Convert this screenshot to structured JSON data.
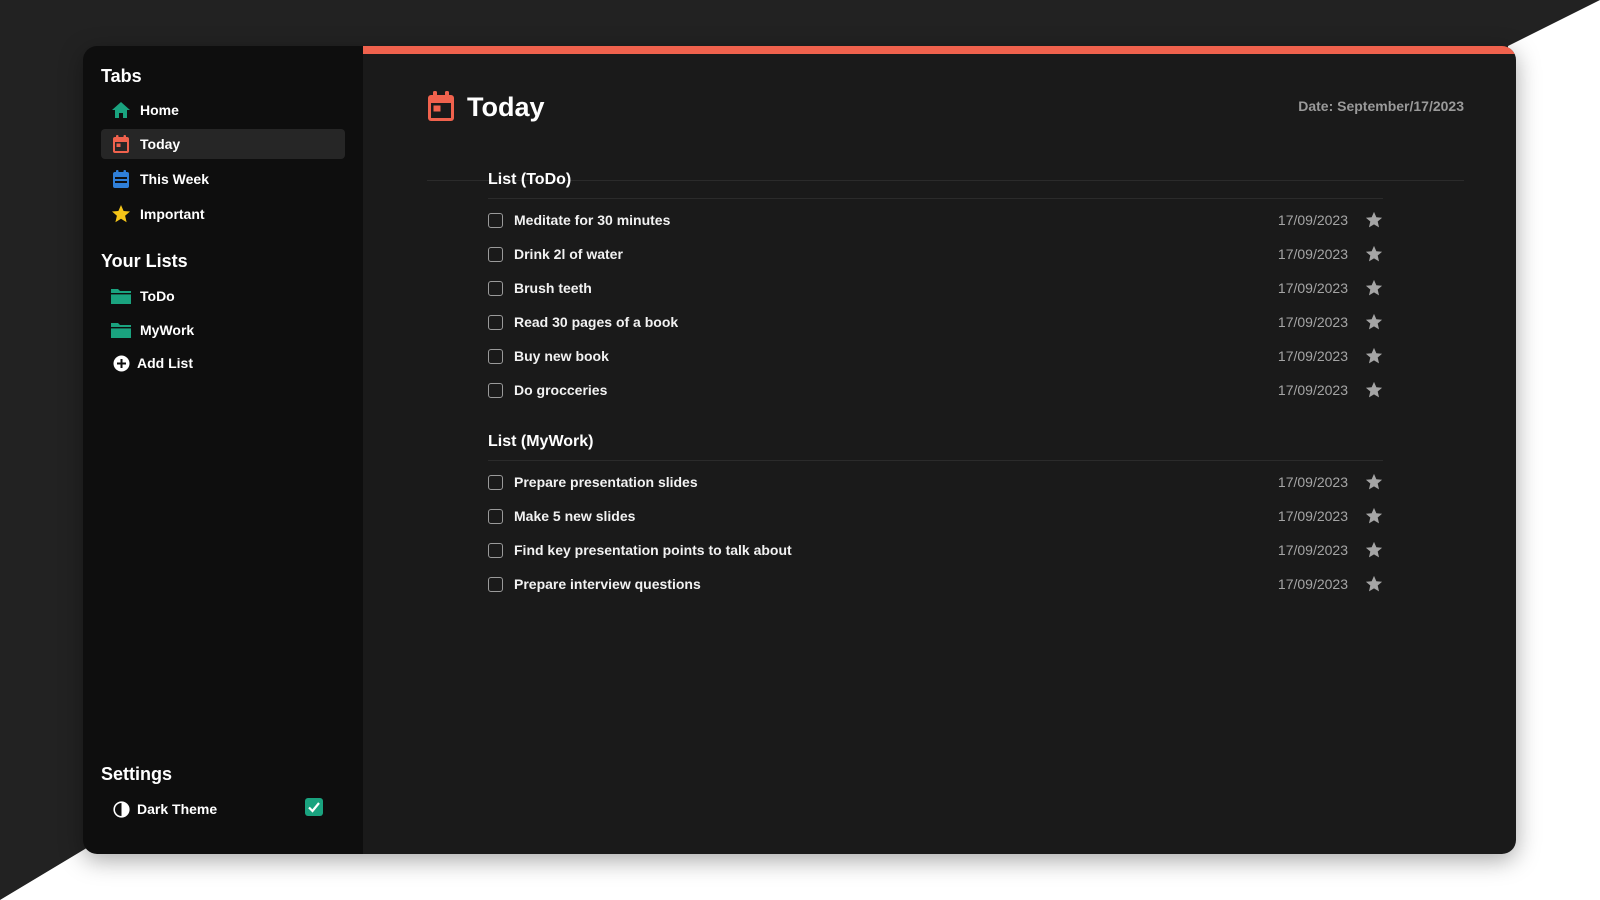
{
  "sidebar": {
    "tabs_title": "Tabs",
    "tabs": [
      {
        "label": "Home",
        "icon": "home-icon",
        "color": "#1aa37f"
      },
      {
        "label": "Today",
        "icon": "calendar-icon",
        "color": "#f0624d",
        "active": true
      },
      {
        "label": "This Week",
        "icon": "calendar-week-icon",
        "color": "#2f7fd8"
      },
      {
        "label": "Important",
        "icon": "star-icon",
        "color": "#f5c518"
      }
    ],
    "lists_title": "Your Lists",
    "lists": [
      {
        "label": "ToDo",
        "icon": "folder-icon",
        "color": "#1aa37f"
      },
      {
        "label": "MyWork",
        "icon": "folder-icon",
        "color": "#1aa37f"
      }
    ],
    "add_list_label": "Add List",
    "settings_title": "Settings",
    "dark_theme_label": "Dark Theme",
    "dark_theme_enabled": true
  },
  "header": {
    "title": "Today",
    "date_label": "Date: September/17/2023",
    "accent_color": "#f0624d"
  },
  "sections": [
    {
      "title": "List (ToDo)",
      "tasks": [
        {
          "text": "Meditate for 30 minutes",
          "date": "17/09/2023"
        },
        {
          "text": "Drink 2l of water",
          "date": "17/09/2023"
        },
        {
          "text": "Brush teeth",
          "date": "17/09/2023"
        },
        {
          "text": "Read 30 pages of a book",
          "date": "17/09/2023"
        },
        {
          "text": "Buy new book",
          "date": "17/09/2023"
        },
        {
          "text": "Do grocceries",
          "date": "17/09/2023"
        }
      ]
    },
    {
      "title": "List (MyWork)",
      "tasks": [
        {
          "text": "Prepare presentation slides",
          "date": "17/09/2023"
        },
        {
          "text": "Make 5 new slides",
          "date": "17/09/2023"
        },
        {
          "text": "Find key presentation points to talk about",
          "date": "17/09/2023"
        },
        {
          "text": "Prepare interview questions",
          "date": "17/09/2023"
        }
      ]
    }
  ]
}
